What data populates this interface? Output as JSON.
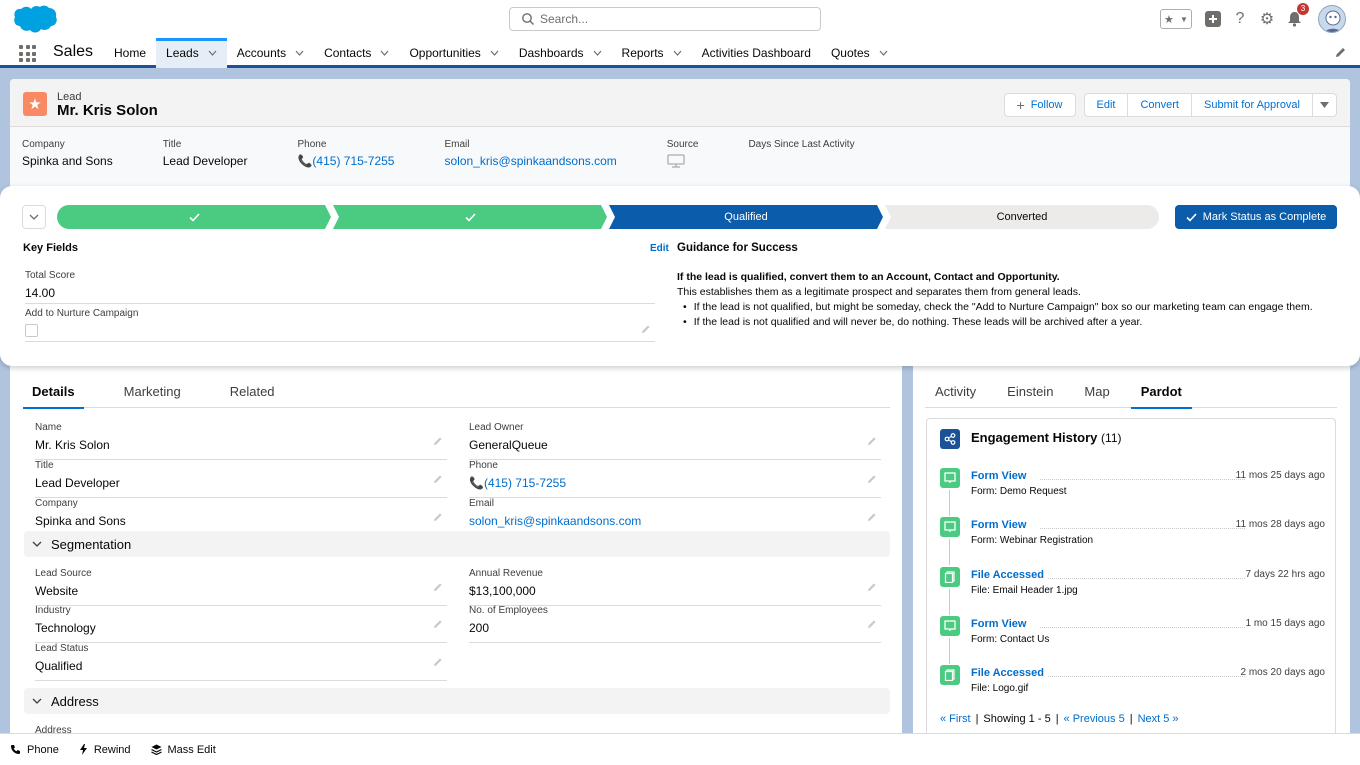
{
  "global": {
    "search_placeholder": "Search...",
    "notification_count": "3"
  },
  "nav": {
    "app_name": "Sales",
    "items": [
      {
        "label": "Home",
        "has_menu": false
      },
      {
        "label": "Leads",
        "has_menu": true,
        "active": true
      },
      {
        "label": "Accounts",
        "has_menu": true
      },
      {
        "label": "Contacts",
        "has_menu": true
      },
      {
        "label": "Opportunities",
        "has_menu": true
      },
      {
        "label": "Dashboards",
        "has_menu": true
      },
      {
        "label": "Reports",
        "has_menu": true
      },
      {
        "label": "Activities Dashboard",
        "has_menu": false
      },
      {
        "label": "Quotes",
        "has_menu": true
      }
    ]
  },
  "record": {
    "object_type": "Lead",
    "name": "Mr. Kris Solon",
    "actions": {
      "follow": "Follow",
      "edit": "Edit",
      "convert": "Convert",
      "submit": "Submit for Approval"
    },
    "highlights": [
      {
        "label": "Company",
        "value": "Spinka and Sons"
      },
      {
        "label": "Title",
        "value": "Lead Developer"
      },
      {
        "label": "Phone",
        "value": "(415) 715-7255"
      },
      {
        "label": "Email",
        "value": "solon_kris@spinkaandsons.com"
      },
      {
        "label": "Source",
        "value": ""
      },
      {
        "label": "Days Since Last Activity",
        "value": ""
      }
    ]
  },
  "path": {
    "steps": [
      {
        "label": "",
        "state": "complete"
      },
      {
        "label": "",
        "state": "complete"
      },
      {
        "label": "Qualified",
        "state": "current"
      },
      {
        "label": "Converted",
        "state": "incomplete"
      }
    ],
    "mark_complete": "Mark Status as Complete",
    "key_fields_title": "Key Fields",
    "edit_label": "Edit",
    "key_fields": {
      "total_score_label": "Total Score",
      "total_score_value": "14.00",
      "nurture_label": "Add to Nurture Campaign"
    },
    "guidance": {
      "title": "Guidance for Success",
      "headline": "If the lead is qualified, convert them to an Account, Contact and Opportunity.",
      "text": "This establishes them as a legitimate prospect and separates them from general leads.",
      "bullets": [
        "If the lead is not qualified, but might be someday, check the \"Add to Nurture Campaign\" box so our marketing team can engage them.",
        "If the lead is not qualified and will never be, do nothing. These leads will be archived after a year."
      ]
    }
  },
  "details": {
    "tabs": [
      "Details",
      "Marketing",
      "Related"
    ],
    "fields_left": [
      {
        "label": "Name",
        "value": "Mr. Kris Solon"
      },
      {
        "label": "Title",
        "value": "Lead Developer"
      },
      {
        "label": "Company",
        "value": "Spinka and Sons"
      }
    ],
    "fields_right": [
      {
        "label": "Lead Owner",
        "value": "GeneralQueue"
      },
      {
        "label": "Phone",
        "value": "(415) 715-7255"
      },
      {
        "label": "Email",
        "value": "solon_kris@spinkaandsons.com"
      }
    ],
    "segmentation_title": "Segmentation",
    "seg_left": [
      {
        "label": "Lead Source",
        "value": "Website"
      },
      {
        "label": "Industry",
        "value": "Technology"
      },
      {
        "label": "Lead Status",
        "value": "Qualified"
      }
    ],
    "seg_right": [
      {
        "label": "Annual Revenue",
        "value": "$13,100,000"
      },
      {
        "label": "No. of Employees",
        "value": "200"
      }
    ],
    "address_title": "Address",
    "address_label": "Address"
  },
  "side": {
    "tabs": [
      "Activity",
      "Einstein",
      "Map",
      "Pardot"
    ],
    "engagement_title": "Engagement History",
    "engagement_count": "(11)",
    "items": [
      {
        "type": "Form View",
        "desc": "Form: Demo Request",
        "time": "11 mos 25 days ago",
        "icon": "form-icon"
      },
      {
        "type": "Form View",
        "desc": "Form: Webinar Registration",
        "time": "11 mos 28 days ago",
        "icon": "form-icon"
      },
      {
        "type": "File Accessed",
        "desc": "File: Email Header 1.jpg",
        "time": "7 days 22 hrs ago",
        "icon": "file-icon"
      },
      {
        "type": "Form View",
        "desc": "Form: Contact Us",
        "time": "1 mo 15 days ago",
        "icon": "form-icon"
      },
      {
        "type": "File Accessed",
        "desc": "File: Logo.gif",
        "time": "2 mos 20 days ago",
        "icon": "file-icon"
      }
    ],
    "pager": {
      "first": "« First",
      "showing": "Showing 1 - 5",
      "prev": "« Previous 5",
      "next": "Next 5 »"
    }
  },
  "utility": {
    "phone": "Phone",
    "rewind": "Rewind",
    "mass_edit": "Mass Edit"
  },
  "colors": {
    "brand": "#0b5cab",
    "path_complete": "#4bca81",
    "lead_icon": "#f88962",
    "link": "#006dcc"
  }
}
